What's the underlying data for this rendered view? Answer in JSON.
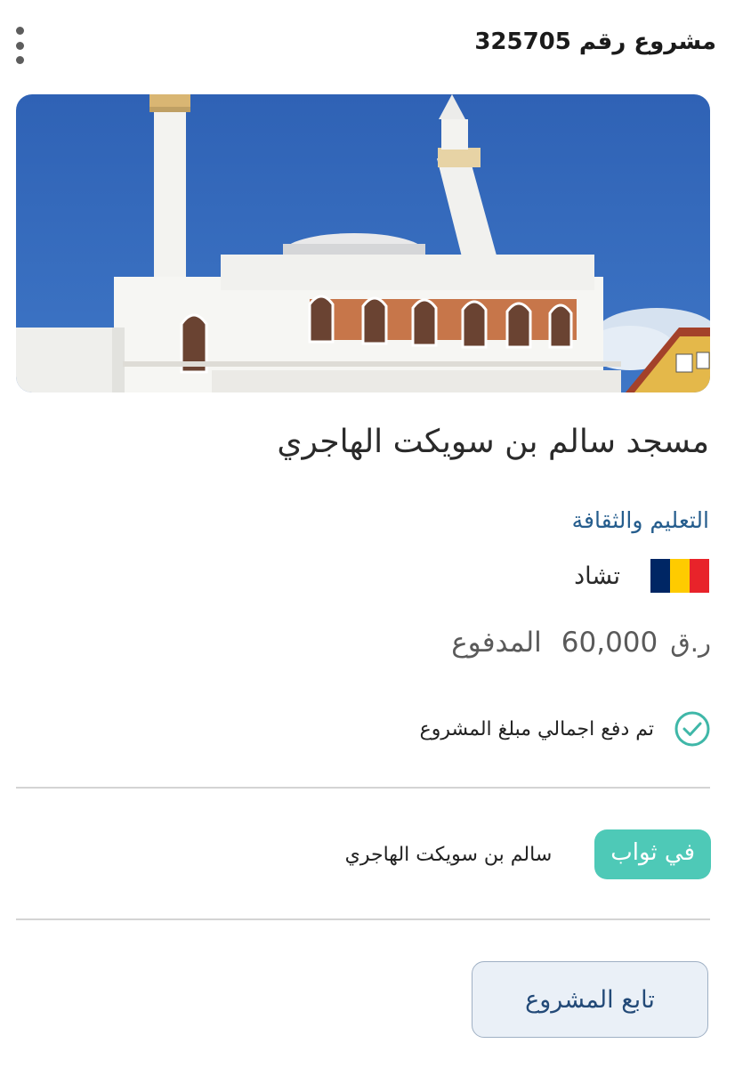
{
  "header": {
    "title": "مشروع رقم 325705",
    "menu_icon": "kebab-menu-icon"
  },
  "project": {
    "image_alt": "mosque-photo",
    "name": "مسجد سالم بن سويكت الهاجري",
    "category": "التعليم والثقافة",
    "country": "تشاد",
    "flag_colors": [
      "#002664",
      "#FECB00",
      "#C60C30"
    ],
    "paid_label": "المدفوع",
    "paid_amount": "60,000",
    "paid_currency": "ر.ق",
    "status_icon": "check-circle-icon",
    "status_text": "تم دفع اجمالي مبلغ المشروع"
  },
  "reward": {
    "badge_label": "في ثواب",
    "donor_name": "سالم بن سويكت الهاجري"
  },
  "actions": {
    "follow_label": "تابع المشروع"
  },
  "colors": {
    "category": "#255d8d",
    "badge": "#4ec9b7",
    "check": "#3fb7a8",
    "button_bg": "#eaf0f7",
    "button_text": "#234a78"
  }
}
